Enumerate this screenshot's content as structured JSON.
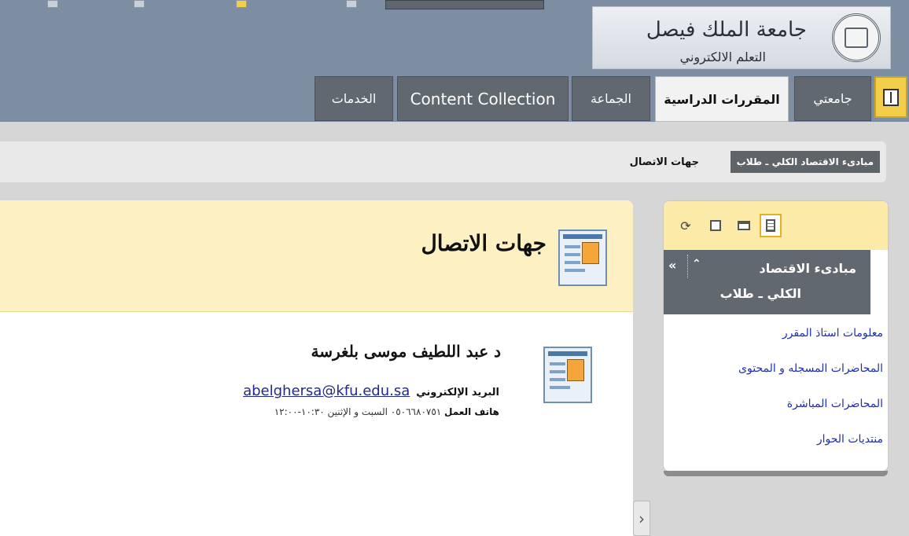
{
  "header": {
    "university_name": "جامعة الملك فيصل",
    "university_sub": "التعلم الالكتروني"
  },
  "tabs": [
    {
      "label": "جامعتي"
    },
    {
      "label": "المقررات الدراسية"
    },
    {
      "label": "الجماعة"
    },
    {
      "label": "Content Collection"
    },
    {
      "label": "الخدمات"
    }
  ],
  "breadcrumb": {
    "course": "مبادىء الاقتصاد الكلي ـ طلاب",
    "page": "جهات الاتصال"
  },
  "course_menu": {
    "course_title_line1": "مبادىء الاقتصاد",
    "course_title_line2": "الكلي ـ طلاب",
    "links": [
      "معلومات استاذ المقرر",
      "المحاضرات المسجله و المحتوى",
      "المحاضرات المباشرة",
      "منتديات الحوار"
    ]
  },
  "content": {
    "page_title": "جهات الاتصال",
    "contact": {
      "name": "د عبد اللطيف موسى بلغرسة",
      "email_label": "البريد الإلكتروني",
      "email": "abelghersa@kfu.edu.sa",
      "phone_label": "هاتف العمل",
      "phone_value": "٠٥٠٦٦٨٠٧٥١ السبت و الإثنين ١٠:٣٠-١٢:٠٠"
    }
  },
  "colors": {
    "header_bg": "#7d8ea3",
    "tab_bg": "#62686f",
    "title_bar": "#fdf1c3",
    "link": "#1d2fb5"
  }
}
